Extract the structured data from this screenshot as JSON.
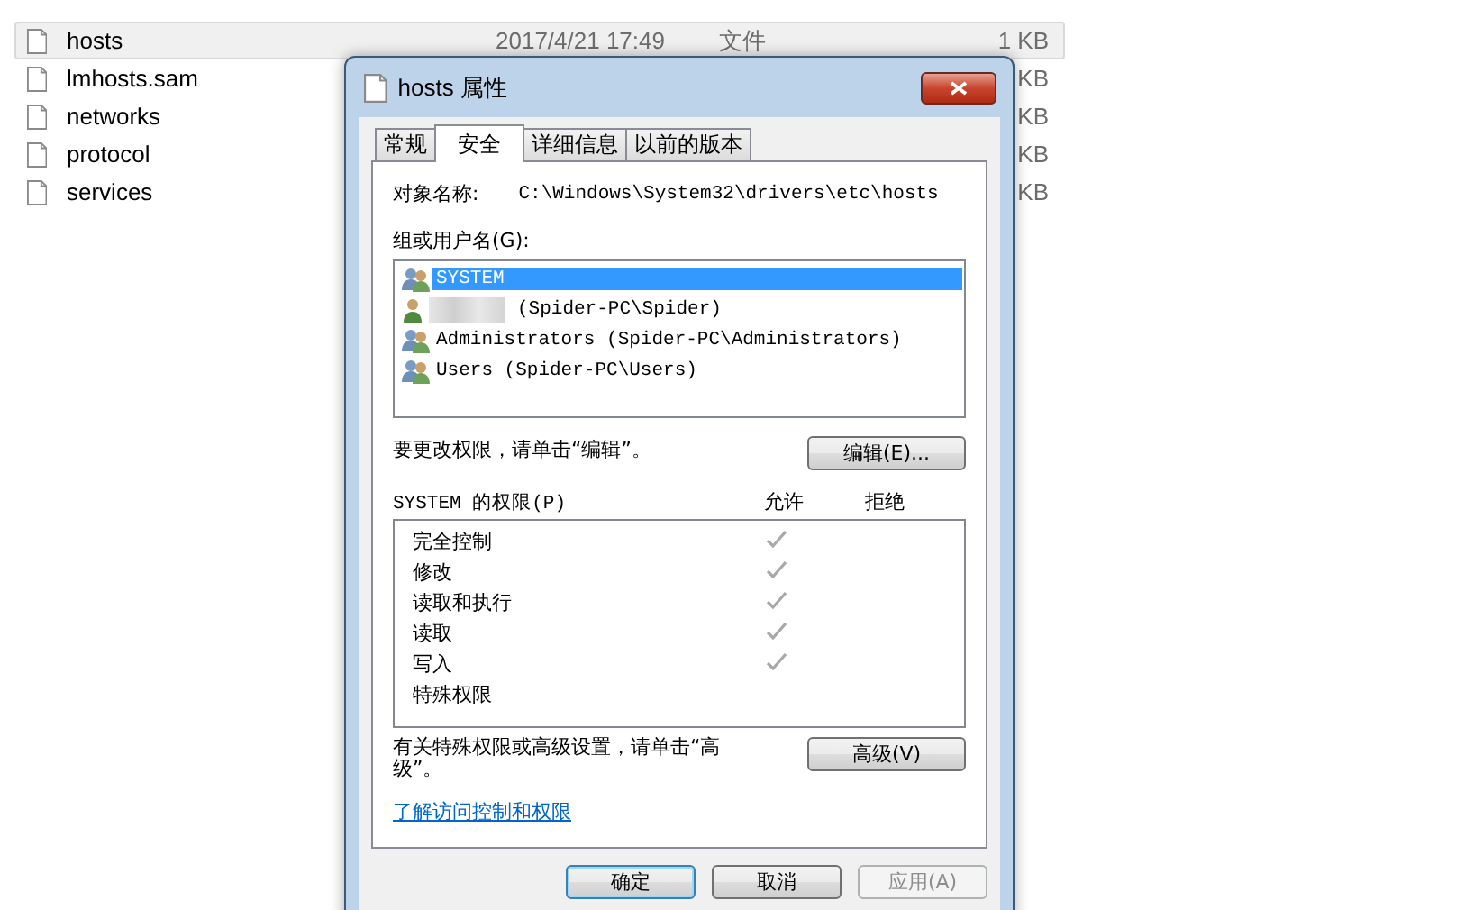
{
  "files": [
    {
      "name": "hosts",
      "selected": true,
      "date": "2017/4/21 17:49",
      "type": "文件",
      "size": "1 KB"
    },
    {
      "name": "lmhosts.sam",
      "selected": false,
      "size": "KB"
    },
    {
      "name": "networks",
      "selected": false,
      "size": "KB"
    },
    {
      "name": "protocol",
      "selected": false,
      "size": "KB"
    },
    {
      "name": "services",
      "selected": false,
      "size": "KB"
    }
  ],
  "dialog": {
    "title": "hosts 属性",
    "tabs": [
      {
        "label": "常规",
        "selected": false
      },
      {
        "label": "安全",
        "selected": true
      },
      {
        "label": "详细信息",
        "selected": false
      },
      {
        "label": "以前的版本",
        "selected": false
      }
    ],
    "object_label": "对象名称:",
    "object_path": "C:\\Windows\\System32\\drivers\\etc\\hosts",
    "groups_label": "组或用户名(G):",
    "groups": [
      {
        "kind": "group",
        "name": "SYSTEM",
        "selected": true
      },
      {
        "kind": "redacted",
        "name": "(Spider-PC\\Spider)",
        "selected": false
      },
      {
        "kind": "group",
        "name": "Administrators (Spider-PC\\Administrators)",
        "selected": false
      },
      {
        "kind": "group",
        "name": "Users (Spider-PC\\Users)",
        "selected": false
      }
    ],
    "edit_hint": "要更改权限，请单击“编辑”。",
    "edit_button": "编辑(E)...",
    "perm_label": "SYSTEM 的权限(P)",
    "allow_header": "允许",
    "deny_header": "拒绝",
    "permissions": [
      {
        "name": "完全控制",
        "allow": true,
        "deny": false
      },
      {
        "name": "修改",
        "allow": true,
        "deny": false
      },
      {
        "name": "读取和执行",
        "allow": true,
        "deny": false
      },
      {
        "name": "读取",
        "allow": true,
        "deny": false
      },
      {
        "name": "写入",
        "allow": true,
        "deny": false
      },
      {
        "name": "特殊权限",
        "allow": false,
        "deny": false
      }
    ],
    "advanced_hint": "有关特殊权限或高级设置，请单击“高级”。",
    "advanced_button": "高级(V)",
    "link": "了解访问控制和权限",
    "buttons": [
      {
        "label": "确定",
        "kind": "default",
        "disabled": false
      },
      {
        "label": "取消",
        "kind": "normal",
        "disabled": false
      },
      {
        "label": "应用(A)",
        "kind": "normal",
        "disabled": true
      }
    ]
  }
}
